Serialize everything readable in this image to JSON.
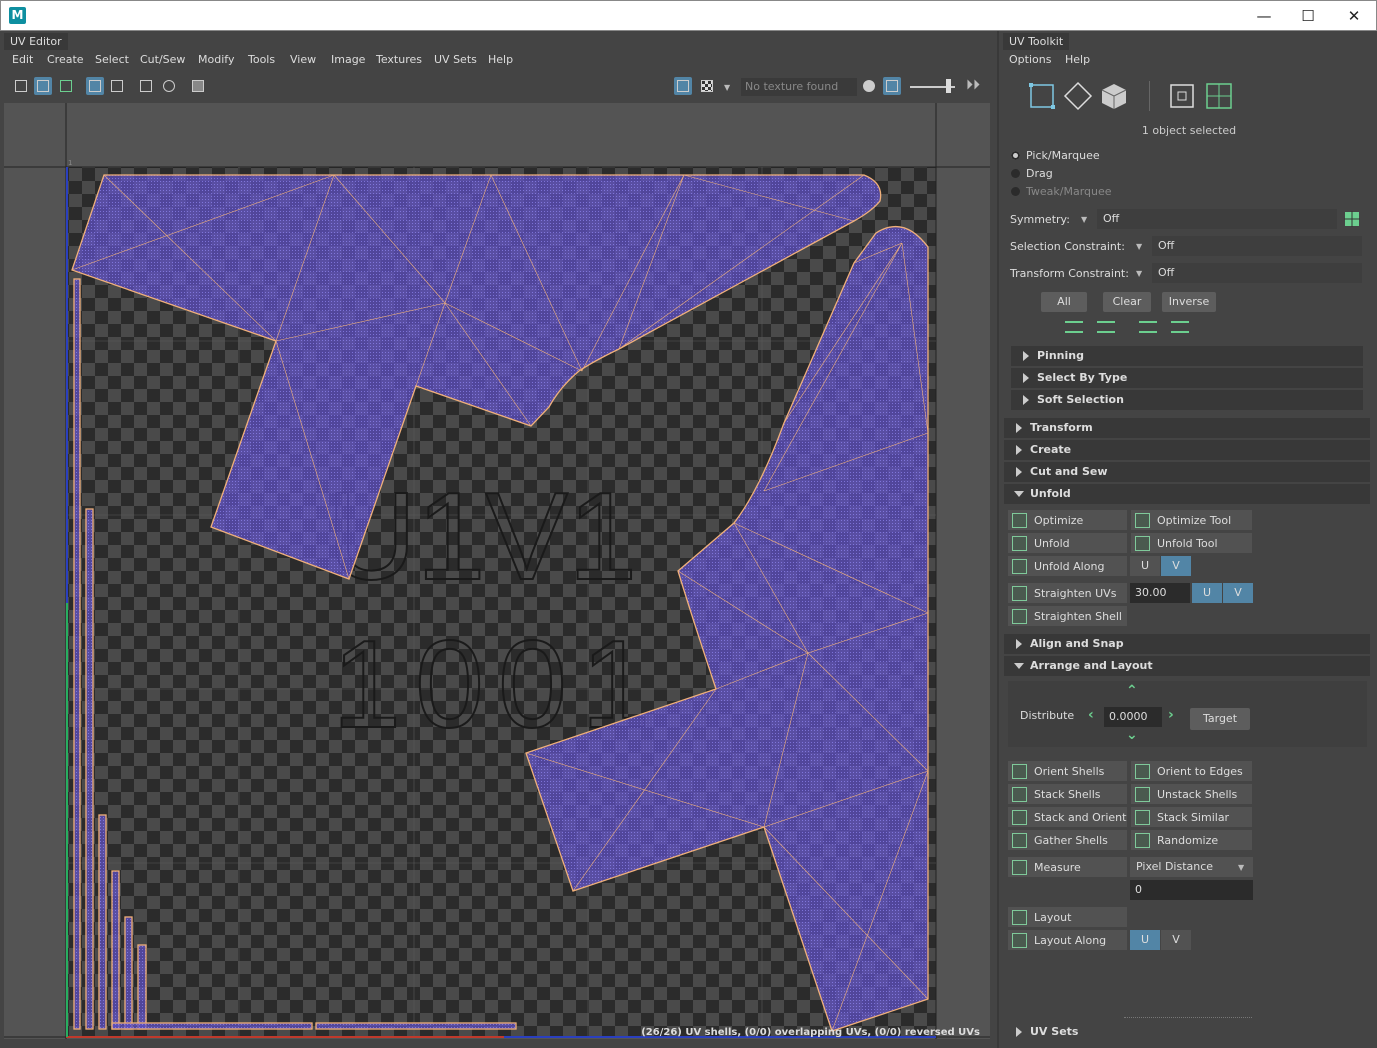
{
  "window": {
    "logo_letter": "M",
    "minimize": "—",
    "maximize": "☐",
    "close": "✕"
  },
  "uv_editor": {
    "title": "UV Editor",
    "menus": [
      "Edit",
      "Create",
      "Select",
      "Cut/Sew",
      "Modify",
      "Tools",
      "View",
      "Image",
      "Textures",
      "UV Sets",
      "Help"
    ],
    "texture_field": "No texture found",
    "tile_label_top": "U1V1",
    "tile_label_bottom": "1001",
    "corner_marker_top_left": "1",
    "corner_marker_bottom_right": "1",
    "status": "(26/26) UV shells, (0/0) overlapping UVs, (0/0) reversed UVs",
    "colors": {
      "shell_fill": "#5d4fc0",
      "shell_edge": "#f0b07a",
      "checker_dark": "#2b2b2b",
      "checker_light": "#4a4a4a"
    }
  },
  "toolkit": {
    "title": "UV Toolkit",
    "menus": [
      "Options",
      "Help"
    ],
    "selected_count": "1 object selected",
    "modes": [
      {
        "label": "Pick/Marquee",
        "selected": true
      },
      {
        "label": "Drag",
        "selected": false
      },
      {
        "label": "Tweak/Marquee",
        "selected": false
      }
    ],
    "symmetry": {
      "label": "Symmetry:",
      "value": "Off"
    },
    "selection_constraint": {
      "label": "Selection Constraint:",
      "value": "Off"
    },
    "transform_constraint": {
      "label": "Transform Constraint:",
      "value": "Off"
    },
    "select_buttons": [
      "All",
      "Clear",
      "Inverse"
    ],
    "sections_top": [
      "Pinning",
      "Select By Type",
      "Soft Selection"
    ],
    "sections_mid": [
      "Transform",
      "Create",
      "Cut and Sew",
      "Unfold"
    ],
    "unfold": {
      "optimize": "Optimize",
      "optimize_tool": "Optimize Tool",
      "unfold": "Unfold",
      "unfold_tool": "Unfold Tool",
      "unfold_along": "Unfold Along",
      "u": "U",
      "v": "V",
      "unfold_along_active": "V",
      "straighten_uvs": "Straighten UVs",
      "straighten_value": "30.00",
      "straighten_shell": "Straighten Shell"
    },
    "sections_after_unfold": [
      "Align and Snap",
      "Arrange and Layout"
    ],
    "arrange": {
      "distribute_label": "Distribute",
      "distribute_value": "0.0000",
      "target": "Target",
      "orient_shells": "Orient Shells",
      "orient_to_edges": "Orient to Edges",
      "stack_shells": "Stack Shells",
      "unstack_shells": "Unstack Shells",
      "stack_and_orient": "Stack and Orient",
      "stack_similar": "Stack Similar",
      "gather_shells": "Gather Shells",
      "randomize_shells": "Randomize Shells",
      "measure": "Measure",
      "measure_mode": "Pixel Distance",
      "measure_value": "0",
      "layout": "Layout",
      "layout_along": "Layout Along",
      "u": "U",
      "v": "V",
      "layout_along_active": "U"
    },
    "uv_sets": "UV Sets"
  }
}
